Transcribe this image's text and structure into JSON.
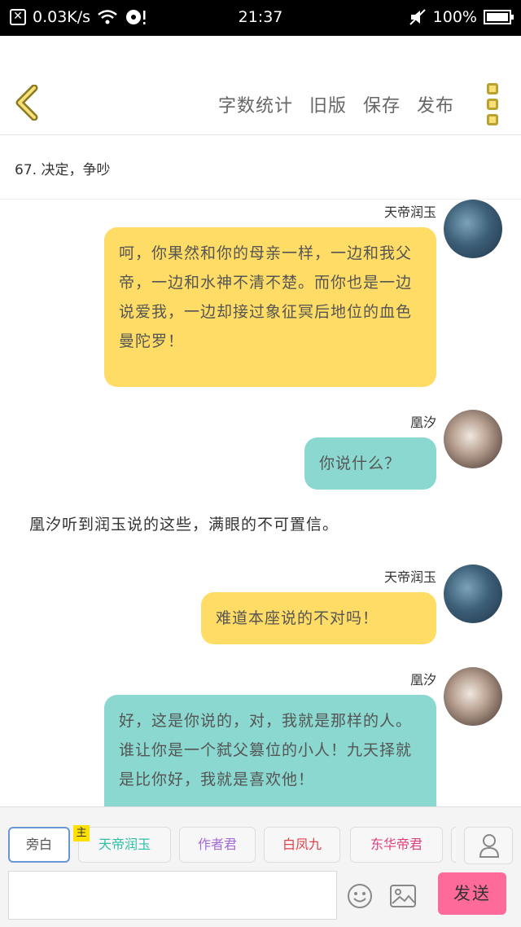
{
  "status_bar": {
    "net_speed": "0.03K/s",
    "time": "21:37",
    "battery": "100%"
  },
  "toolbar": {
    "word_count": "字数统计",
    "old_version": "旧版",
    "save": "保存",
    "publish": "发布"
  },
  "chapter_title": "67. 决定，争吵",
  "messages": [
    {
      "speaker": "天帝润玉",
      "text": "呵，你果然和你的母亲一样，一边和我父帝，一边和水神不清不楚。而你也是一边说爱我，一边却接过象征冥后地位的血色曼陀罗！"
    },
    {
      "speaker": "凰汐",
      "text": "你说什么？"
    },
    {
      "narration": "凰汐听到润玉说的这些，满眼的不可置信。"
    },
    {
      "speaker": "天帝润玉",
      "text": "难道本座说的不对吗！"
    },
    {
      "speaker": "凰汐",
      "text": "好，这是你说的，对，我就是那样的人。谁让你是一个弑父篡位的小人！九天择就是比你好，我就是喜欢他！"
    }
  ],
  "characters": [
    {
      "label": "旁白",
      "color": "#555555"
    },
    {
      "label": "天帝润玉",
      "color": "#2fbfa6",
      "badge": "主"
    },
    {
      "label": "作者君",
      "color": "#a569d8"
    },
    {
      "label": "白凤九",
      "color": "#e0414b"
    },
    {
      "label": "东华帝君",
      "color": "#e0417e"
    }
  ],
  "send_label": "发送",
  "colors": {
    "bubble_yellow": "#fedc65",
    "bubble_teal": "#8ad8cf",
    "send_pink": "#fe6a9a",
    "accent_yellow": "#f7e07a"
  }
}
